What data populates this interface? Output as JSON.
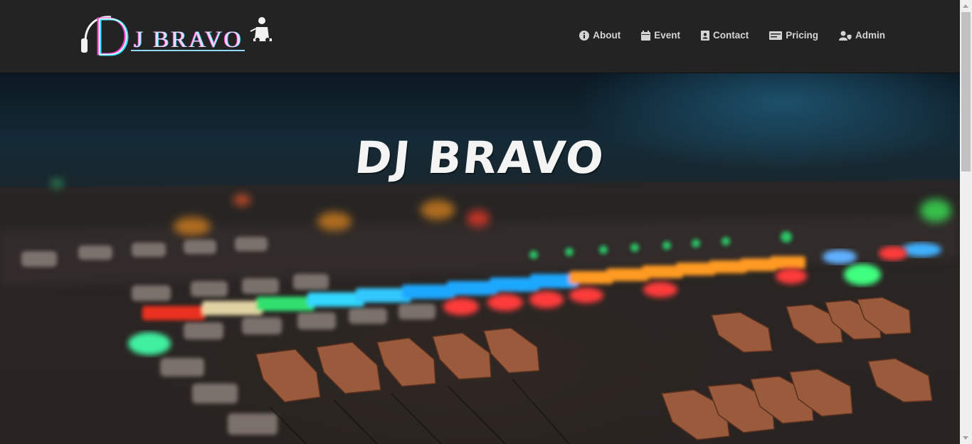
{
  "brand": {
    "logo_text": "J BRAVO",
    "logo_letter": "D"
  },
  "nav": {
    "items": [
      {
        "label": "About",
        "icon": "info-circle-icon"
      },
      {
        "label": "Event",
        "icon": "calendar-icon"
      },
      {
        "label": "Contact",
        "icon": "contact-card-icon"
      },
      {
        "label": "Pricing",
        "icon": "money-bill-icon"
      },
      {
        "label": "Admin",
        "icon": "user-shield-icon"
      }
    ]
  },
  "hero": {
    "title": "DJ BRAVO"
  },
  "colors": {
    "navbar": "#232323",
    "nav_text": "#d4d4d4",
    "logo_pink": "#ff3fcf",
    "logo_cyan": "#38e1ff"
  }
}
